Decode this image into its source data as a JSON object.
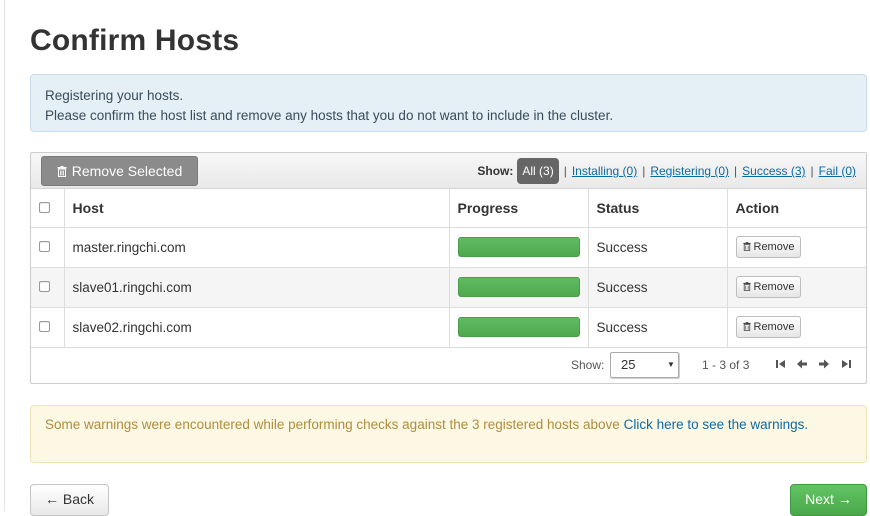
{
  "page": {
    "title": "Confirm Hosts"
  },
  "info": {
    "line1": "Registering your hosts.",
    "line2": "Please confirm the host list and remove any hosts that you do not want to include in the cluster."
  },
  "toolbar": {
    "remove_selected_label": "Remove Selected",
    "show_label": "Show:",
    "filters": [
      {
        "label": "All (3)",
        "active": true
      },
      {
        "label": "Installing (0)",
        "active": false
      },
      {
        "label": "Registering (0)",
        "active": false
      },
      {
        "label": "Success (3)",
        "active": false
      },
      {
        "label": "Fail (0)",
        "active": false
      }
    ]
  },
  "table": {
    "columns": [
      "Host",
      "Progress",
      "Status",
      "Action"
    ],
    "rows": [
      {
        "host": "master.ringchi.com",
        "progress": 1.0,
        "status": "Success",
        "action": "Remove"
      },
      {
        "host": "slave01.ringchi.com",
        "progress": 1.0,
        "status": "Success",
        "action": "Remove"
      },
      {
        "host": "slave02.ringchi.com",
        "progress": 1.0,
        "status": "Success",
        "action": "Remove"
      }
    ]
  },
  "pager": {
    "show_label": "Show:",
    "page_size": "25",
    "range": "1 - 3 of 3",
    "icons": [
      "first-page-icon",
      "prev-page-icon",
      "next-page-icon",
      "last-page-icon"
    ]
  },
  "warning": {
    "text": "Some warnings were encountered while performing checks against the 3 registered hosts above ",
    "link": "Click here to see the warnings."
  },
  "footer": {
    "back_label": "← Back",
    "next_label": "Next →"
  },
  "colors": {
    "info_bg": "#e4eff6",
    "warning_bg": "#fcf8e3",
    "success_text": "#3d8a2e",
    "progress_fill": "#58b058",
    "next_button": "#5bb75b",
    "link": "#0b6aa8"
  }
}
